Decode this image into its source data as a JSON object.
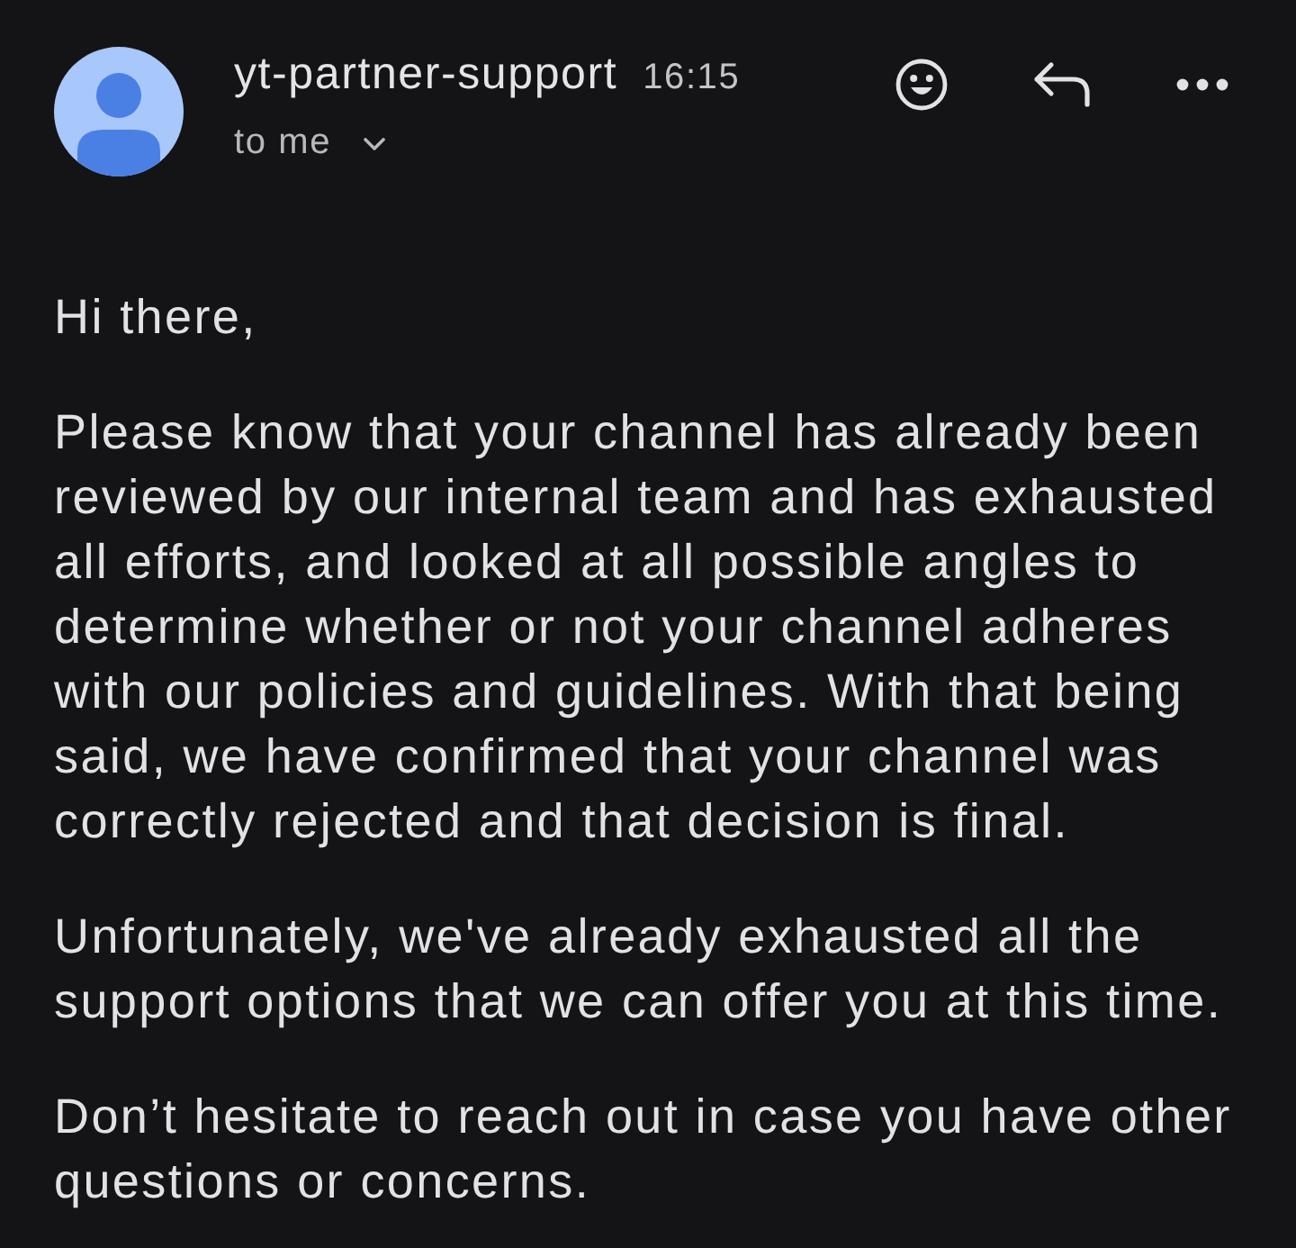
{
  "header": {
    "sender": "yt-partner-support",
    "time": "16:15",
    "recipient": "to me"
  },
  "body": {
    "paragraphs": [
      {
        "lines": [
          "Hi there,"
        ]
      },
      {
        "lines": [
          "Please know that your channel has already been",
          "reviewed by our internal team and has exhausted",
          "all efforts, and looked at all possible angles to",
          "determine whether or not your channel adheres",
          "with our policies and guidelines. With that being",
          "said, we have confirmed that your channel was",
          "correctly rejected and that decision is final."
        ]
      },
      {
        "lines": [
          "Unfortunately, we've already exhausted all the",
          "support options that we can offer you at this time."
        ]
      },
      {
        "lines": [
          "Don’t hesitate to reach out in case you have other",
          "questions or concerns."
        ]
      }
    ]
  }
}
